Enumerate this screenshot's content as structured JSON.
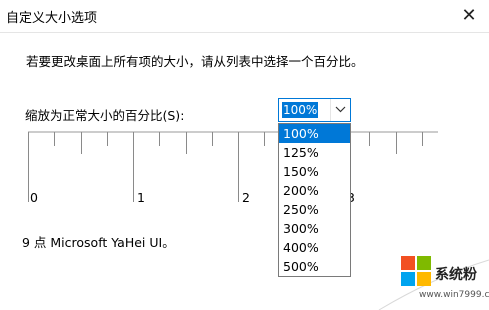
{
  "window": {
    "title": "自定义大小选项",
    "close_glyph": "✕"
  },
  "instruction": "若要更改桌面上所有项的大小，请从列表中选择一个百分比。",
  "scale": {
    "label": "缩放为正常大小的百分比(S):",
    "value": "100%"
  },
  "dropdown": {
    "options": [
      "100%",
      "125%",
      "150%",
      "200%",
      "250%",
      "300%",
      "400%",
      "500%"
    ],
    "selected_index": 0
  },
  "ruler": {
    "numbers": [
      "0",
      "1",
      "2",
      "3"
    ]
  },
  "sample_text": "9 点 Microsoft YaHei UI。",
  "watermark": {
    "brand": "系统粉",
    "url": "www.win7999.com"
  },
  "colors": {
    "accent": "#0078d7",
    "logo_red": "#f25022",
    "logo_green": "#7fba00",
    "logo_blue": "#00a4ef",
    "logo_yellow": "#ffb900"
  }
}
